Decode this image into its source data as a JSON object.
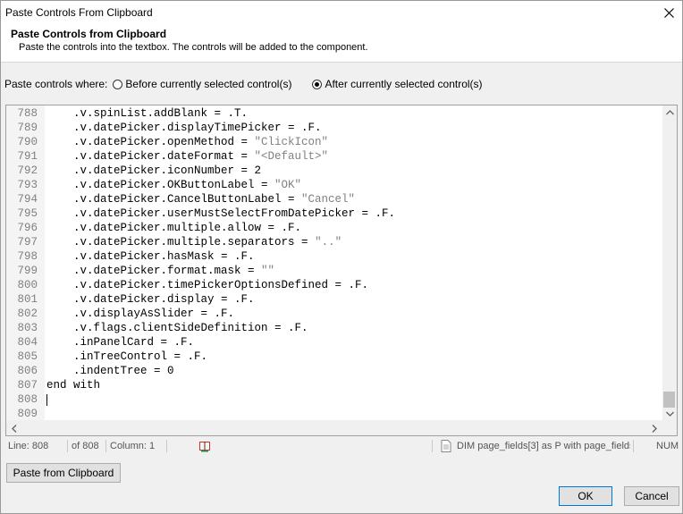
{
  "window": {
    "title": "Paste Controls From Clipboard"
  },
  "header": {
    "title": "Paste Controls from Clipboard",
    "description": "Paste the controls into the textbox. The controls will be added to the component."
  },
  "paste_where": {
    "label": "Paste controls where:",
    "options": [
      {
        "label": "Before currently selected control(s)",
        "selected": false
      },
      {
        "label": "After currently selected control(s)",
        "selected": true
      }
    ]
  },
  "editor": {
    "lines": [
      {
        "n": "788",
        "code": "    .v.spinList.addBlank = .T.",
        "str": ""
      },
      {
        "n": "789",
        "code": "    .v.datePicker.displayTimePicker = .F.",
        "str": ""
      },
      {
        "n": "790",
        "code": "    .v.datePicker.openMethod = ",
        "str": "\"ClickIcon\""
      },
      {
        "n": "791",
        "code": "    .v.datePicker.dateFormat = ",
        "str": "\"<Default>\""
      },
      {
        "n": "792",
        "code": "    .v.datePicker.iconNumber = 2",
        "str": ""
      },
      {
        "n": "793",
        "code": "    .v.datePicker.OKButtonLabel = ",
        "str": "\"OK\""
      },
      {
        "n": "794",
        "code": "    .v.datePicker.CancelButtonLabel = ",
        "str": "\"Cancel\""
      },
      {
        "n": "795",
        "code": "    .v.datePicker.userMustSelectFromDatePicker = .F.",
        "str": ""
      },
      {
        "n": "796",
        "code": "    .v.datePicker.multiple.allow = .F.",
        "str": ""
      },
      {
        "n": "797",
        "code": "    .v.datePicker.multiple.separators = ",
        "str": "\"..\""
      },
      {
        "n": "798",
        "code": "    .v.datePicker.hasMask = .F.",
        "str": ""
      },
      {
        "n": "799",
        "code": "    .v.datePicker.format.mask = ",
        "str": "\"\""
      },
      {
        "n": "800",
        "code": "    .v.datePicker.timePickerOptionsDefined = .F.",
        "str": ""
      },
      {
        "n": "801",
        "code": "    .v.datePicker.display = .F.",
        "str": ""
      },
      {
        "n": "802",
        "code": "    .v.displayAsSlider = .F.",
        "str": ""
      },
      {
        "n": "803",
        "code": "    .v.flags.clientSideDefinition = .F.",
        "str": ""
      },
      {
        "n": "804",
        "code": "    .inPanelCard = .F.",
        "str": ""
      },
      {
        "n": "805",
        "code": "    .inTreeControl = .F.",
        "str": ""
      },
      {
        "n": "806",
        "code": "    .indentTree = 0",
        "str": ""
      },
      {
        "n": "807",
        "code": "end with",
        "str": ""
      },
      {
        "n": "808",
        "code": "",
        "str": ""
      },
      {
        "n": "809",
        "code": "",
        "str": ""
      }
    ]
  },
  "status": {
    "line": "Line: 808",
    "of": "of 808",
    "column": "Column: 1",
    "context": "DIM page_fields[3] as P with page_fields",
    "num": "NUM"
  },
  "buttons": {
    "paste": "Paste from Clipboard",
    "ok": "OK",
    "cancel": "Cancel"
  },
  "icons": {
    "close": "close-icon",
    "status_book": "book-icon",
    "status_doc": "document-icon"
  }
}
